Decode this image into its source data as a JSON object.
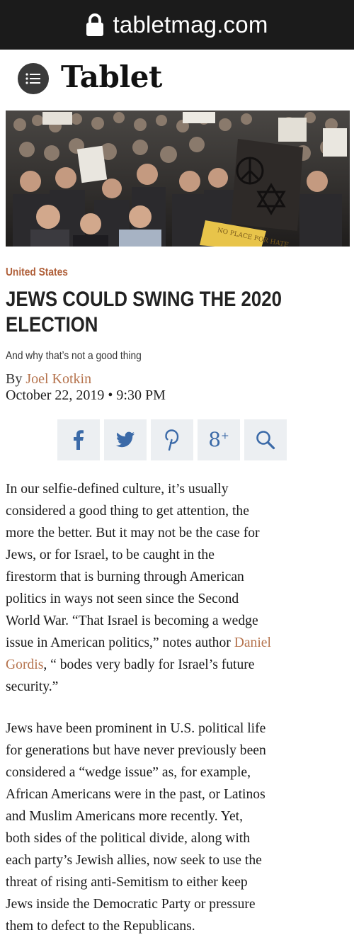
{
  "browser": {
    "domain": "tabletmag.com"
  },
  "site": {
    "logo": "Tablet"
  },
  "article": {
    "section": "United States",
    "headline_line1": "JEWS COULD SWING THE 2020",
    "headline_line2": "ELECTION",
    "subhead": "And why that’s not a good thing",
    "by_prefix": "By ",
    "author": "Joel Kotkin",
    "date": "October 22, 2019 • 9:30 PM",
    "photo_signs": [
      "NO PLACE FOR HATE"
    ],
    "share": [
      "facebook-icon",
      "twitter-icon",
      "pinterest-icon",
      "google-plus-icon",
      "search-icon"
    ],
    "paragraph1": {
      "l1": "In our selfie-defined culture, it’s usually",
      "l2": "considered a good thing to get attention, the",
      "l3": "more the better. But it may not be the case for",
      "l4": "Jews, or for Israel, to be  caught in the",
      "l5": "firestorm that is burning through American",
      "l6": "politics in ways not seen since the Second",
      "l7": "World War. “That Israel is becoming a wedge",
      "l8a": "issue in American politics,” notes author ",
      "l8link": "Daniel",
      "l9link": "Gordis",
      "l9b": ", “ bodes very badly for Israel’s future",
      "l10": "security.”"
    },
    "paragraph2": {
      "l1": "Jews have been prominent in U.S. political life",
      "l2": "for generations but have never previously been",
      "l3": "considered a “wedge issue” as, for example,",
      "l4": "African Americans were in the past, or Latinos",
      "l5": "and Muslim Americans  more recently. Yet,",
      "l6": "both sides of the political divide, along with",
      "l7": "each party’s Jewish allies, now seek to use the",
      "l8": "threat of rising anti-Semitism to either keep",
      "l9": "Jews inside the Democratic Party or pressure",
      "l10": "them to defect to the Republicans."
    }
  }
}
